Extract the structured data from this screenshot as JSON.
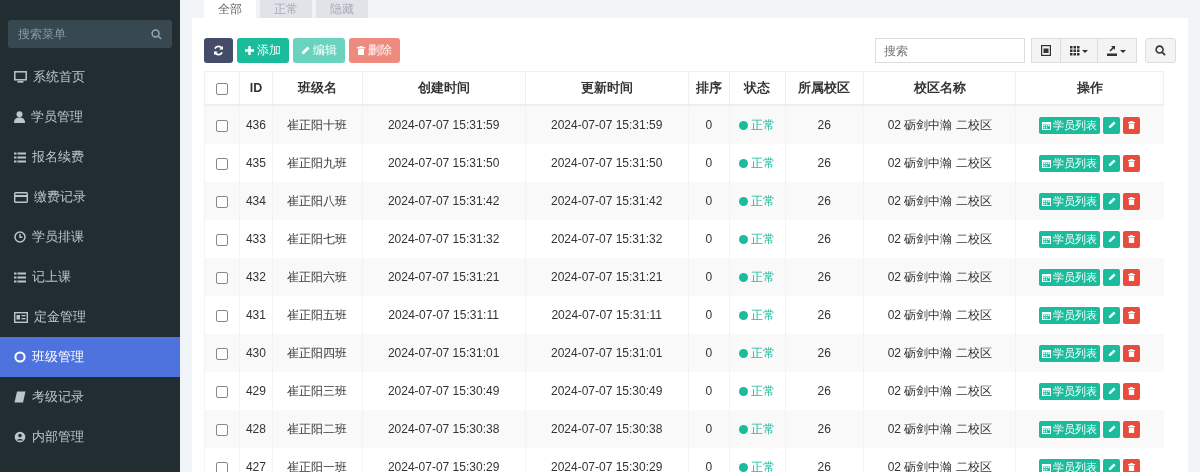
{
  "sidebar": {
    "search": {
      "placeholder": "搜索菜单"
    },
    "items": [
      {
        "label": "系统首页",
        "selected": false
      },
      {
        "label": "学员管理",
        "selected": false
      },
      {
        "label": "报名续费",
        "selected": false
      },
      {
        "label": "缴费记录",
        "selected": false
      },
      {
        "label": "学员排课",
        "selected": false
      },
      {
        "label": "记上课",
        "selected": false
      },
      {
        "label": "定金管理",
        "selected": false
      },
      {
        "label": "班级管理",
        "selected": true
      },
      {
        "label": "考级记录",
        "selected": false
      },
      {
        "label": "内部管理",
        "selected": false
      }
    ]
  },
  "tabs": [
    {
      "label": "全部",
      "selected": true
    },
    {
      "label": "正常",
      "selected": false
    },
    {
      "label": "隐藏",
      "selected": false
    }
  ],
  "toolbar": {
    "buttons": [
      {
        "kind": "refresh"
      },
      {
        "kind": "add",
        "label": "添加",
        "disabled": false
      },
      {
        "kind": "edit",
        "label": "编辑",
        "disabled": true
      },
      {
        "kind": "delete",
        "label": "删除",
        "disabled": true
      }
    ],
    "search": {
      "placeholder": "搜索"
    }
  },
  "table": {
    "all_checked": false,
    "columns": [
      "ID",
      "班级名",
      "创建时间",
      "更新时间",
      "排序",
      "状态",
      "所属校区",
      "校区名称",
      "操作"
    ],
    "rows": [
      {
        "id": "436",
        "name": "崔正阳十班",
        "created": "2024-07-07 15:31:59",
        "updated": "2024-07-07 15:31:59",
        "sort": "0",
        "status": "正常",
        "campus": "26",
        "campus_name": "02 砺剑中瀚 二校区",
        "action": "学员列表",
        "checked": false
      },
      {
        "id": "435",
        "name": "崔正阳九班",
        "created": "2024-07-07 15:31:50",
        "updated": "2024-07-07 15:31:50",
        "sort": "0",
        "status": "正常",
        "campus": "26",
        "campus_name": "02 砺剑中瀚 二校区",
        "action": "学员列表",
        "checked": false
      },
      {
        "id": "434",
        "name": "崔正阳八班",
        "created": "2024-07-07 15:31:42",
        "updated": "2024-07-07 15:31:42",
        "sort": "0",
        "status": "正常",
        "campus": "26",
        "campus_name": "02 砺剑中瀚 二校区",
        "action": "学员列表",
        "checked": false
      },
      {
        "id": "433",
        "name": "崔正阳七班",
        "created": "2024-07-07 15:31:32",
        "updated": "2024-07-07 15:31:32",
        "sort": "0",
        "status": "正常",
        "campus": "26",
        "campus_name": "02 砺剑中瀚 二校区",
        "action": "学员列表",
        "checked": false
      },
      {
        "id": "432",
        "name": "崔正阳六班",
        "created": "2024-07-07 15:31:21",
        "updated": "2024-07-07 15:31:21",
        "sort": "0",
        "status": "正常",
        "campus": "26",
        "campus_name": "02 砺剑中瀚 二校区",
        "action": "学员列表",
        "checked": false
      },
      {
        "id": "431",
        "name": "崔正阳五班",
        "created": "2024-07-07 15:31:11",
        "updated": "2024-07-07 15:31:11",
        "sort": "0",
        "status": "正常",
        "campus": "26",
        "campus_name": "02 砺剑中瀚 二校区",
        "action": "学员列表",
        "checked": false
      },
      {
        "id": "430",
        "name": "崔正阳四班",
        "created": "2024-07-07 15:31:01",
        "updated": "2024-07-07 15:31:01",
        "sort": "0",
        "status": "正常",
        "campus": "26",
        "campus_name": "02 砺剑中瀚 二校区",
        "action": "学员列表",
        "checked": false
      },
      {
        "id": "429",
        "name": "崔正阳三班",
        "created": "2024-07-07 15:30:49",
        "updated": "2024-07-07 15:30:49",
        "sort": "0",
        "status": "正常",
        "campus": "26",
        "campus_name": "02 砺剑中瀚 二校区",
        "action": "学员列表",
        "checked": false
      },
      {
        "id": "428",
        "name": "崔正阳二班",
        "created": "2024-07-07 15:30:38",
        "updated": "2024-07-07 15:30:38",
        "sort": "0",
        "status": "正常",
        "campus": "26",
        "campus_name": "02 砺剑中瀚 二校区",
        "action": "学员列表",
        "checked": false
      },
      {
        "id": "427",
        "name": "崔正阳一班",
        "created": "2024-07-07 15:30:29",
        "updated": "2024-07-07 15:30:29",
        "sort": "0",
        "status": "正常",
        "campus": "26",
        "campus_name": "02 砺剑中瀚 二校区",
        "action": "学员列表",
        "checked": false
      }
    ]
  }
}
